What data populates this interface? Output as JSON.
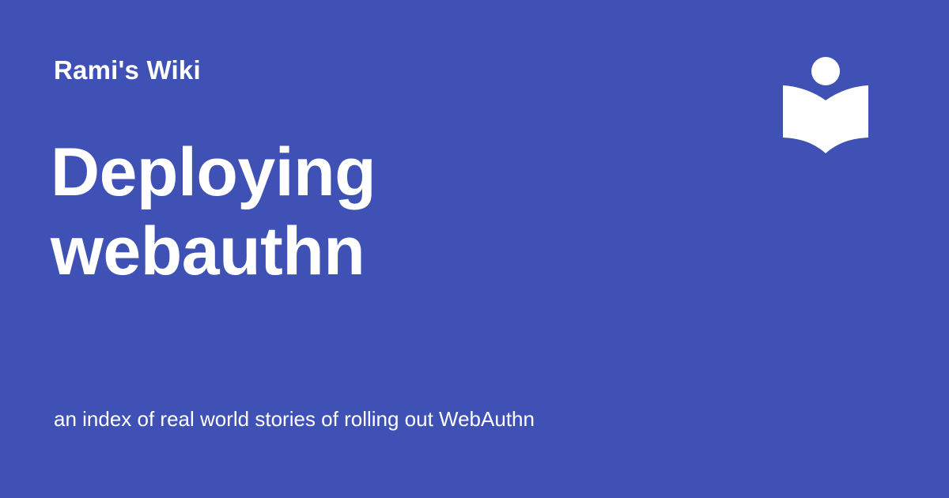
{
  "site": {
    "name": "Rami's Wiki"
  },
  "page": {
    "title": "Deploying webauthn",
    "description": "an index of real world stories of rolling out WebAuthn"
  },
  "logo": {
    "icon": "book-reader-icon"
  },
  "colors": {
    "background": "#3f51b5",
    "foreground": "#ffffff"
  }
}
